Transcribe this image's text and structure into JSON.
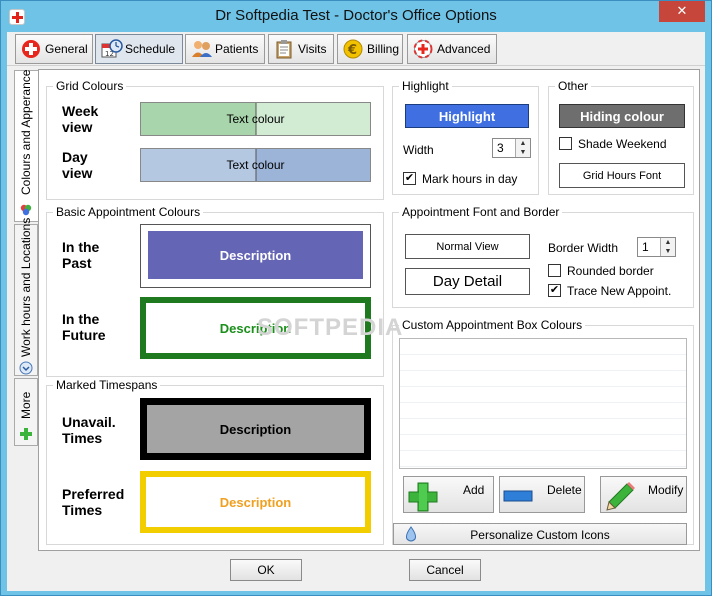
{
  "window": {
    "title": "Dr Softpedia Test - Doctor's Office Options",
    "close_glyph": "✕"
  },
  "toolbar": {
    "tabs": [
      {
        "label": "General",
        "icon": "red-cross-icon"
      },
      {
        "label": "Schedule",
        "icon": "calendar-clock-icon"
      },
      {
        "label": "Patients",
        "icon": "people-icon"
      },
      {
        "label": "Visits",
        "icon": "clipboard-icon"
      },
      {
        "label": "Billing",
        "icon": "euro-coin-icon"
      },
      {
        "label": "Advanced",
        "icon": "medical-kit-icon"
      }
    ],
    "active": "Schedule"
  },
  "side_tabs": [
    {
      "label": "Colours and Apperance"
    },
    {
      "label": "Work hours and Locations"
    },
    {
      "label": "More"
    }
  ],
  "grid_colours": {
    "title": "Grid Colours",
    "week": {
      "label_1": "Week",
      "label_2": "view",
      "text": "Text colour",
      "left_color": "#a8d5ab",
      "right_color": "#d2ebd3"
    },
    "day": {
      "label_1": "Day",
      "label_2": "view",
      "text": "Text colour",
      "left_color": "#b4c8e2",
      "right_color": "#9cb4d8"
    }
  },
  "basic_colours": {
    "title": "Basic Appointment Colours",
    "past": {
      "label_1": "In the",
      "label_2": "Past",
      "text": "Description",
      "bg": "#6565b6",
      "fg": "#ffffff"
    },
    "future": {
      "label_1": "In the",
      "label_2": "Future",
      "text": "Description",
      "border": "#1f7a1f",
      "fg": "#1a8f1a"
    }
  },
  "marked": {
    "title": "Marked Timespans",
    "unavail": {
      "label_1": "Unavail.",
      "label_2": "Times",
      "text": "Description",
      "border": "#000000",
      "bg": "#a4a4a4"
    },
    "preferred": {
      "label_1": "Preferred",
      "label_2": "Times",
      "text": "Description",
      "border": "#f2cd00",
      "fg": "#f0a020"
    }
  },
  "highlight": {
    "title": "Highlight",
    "button": "Highlight",
    "color": "#3f6fe0",
    "width_label": "Width",
    "width_value": "3",
    "mark_hours_label": "Mark hours in day",
    "mark_hours_checked": true
  },
  "other": {
    "title": "Other",
    "hiding_button": "Hiding colour",
    "hiding_color": "#6e6e6e",
    "shade_weekend_label": "Shade Weekend",
    "shade_weekend_checked": false,
    "grid_font_button": "Grid Hours Font"
  },
  "font_border": {
    "title": "Appointment Font and Border",
    "normal_view": "Normal View",
    "day_detail": "Day Detail",
    "border_width_label": "Border Width",
    "border_width_value": "1",
    "rounded_label": "Rounded border",
    "rounded_checked": false,
    "trace_label": "Trace New Appoint.",
    "trace_checked": true
  },
  "custom": {
    "title": "Custom Appointment Box Colours",
    "add": "Add",
    "delete": "Delete",
    "modify": "Modify",
    "personalize": "Personalize Custom Icons"
  },
  "watermark": "SOFTPEDIA",
  "footer": {
    "ok": "OK",
    "cancel": "Cancel"
  }
}
